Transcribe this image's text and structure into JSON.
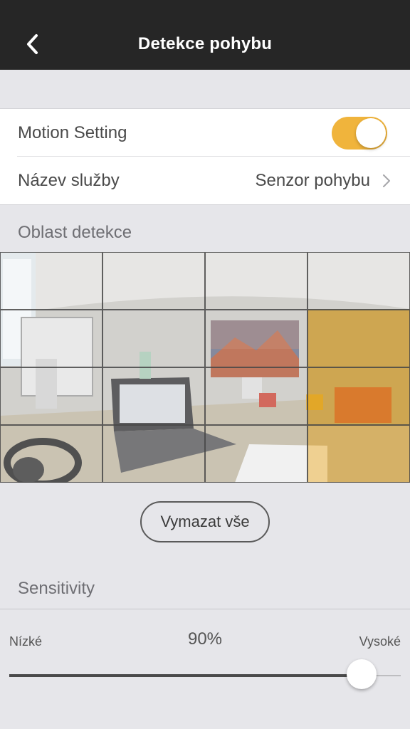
{
  "navbar": {
    "title": "Detekce pohybu",
    "back_icon": "chevron-left-icon"
  },
  "settings": {
    "motion_label": "Motion Setting",
    "motion_enabled": true,
    "toggle_color": "#f0b43c",
    "service_label": "Název služby",
    "service_value": "Senzor pohybu"
  },
  "detection": {
    "section_title": "Oblast detekce",
    "grid_rows": 4,
    "grid_cols": 4,
    "active_cells": [
      [
        1,
        3
      ],
      [
        2,
        3
      ],
      [
        3,
        3
      ]
    ],
    "active_color": "#f0aa1e",
    "clear_label": "Vymazat vše"
  },
  "sensitivity": {
    "section_title": "Sensitivity",
    "low_label": "Nízké",
    "high_label": "Vysoké",
    "value_label": "90%",
    "value": 0.9
  }
}
